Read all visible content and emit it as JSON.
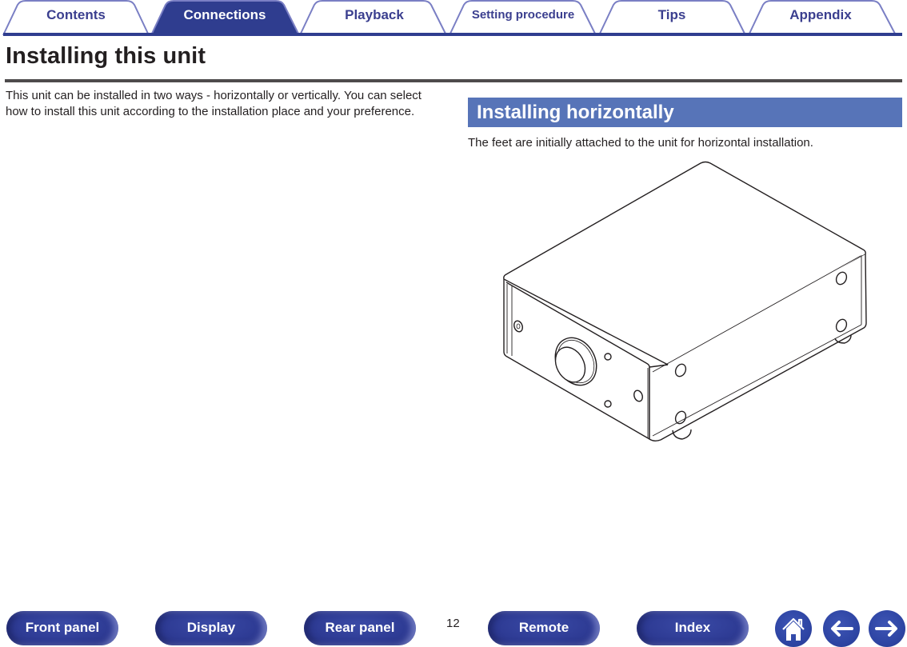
{
  "tabs": [
    {
      "label": "Contents",
      "active": false
    },
    {
      "label": "Connections",
      "active": true
    },
    {
      "label": "Playback",
      "active": false
    },
    {
      "label": "Setting procedure",
      "active": false
    },
    {
      "label": "Tips",
      "active": false
    },
    {
      "label": "Appendix",
      "active": false
    }
  ],
  "page": {
    "title": "Installing this unit",
    "intro": "This unit can be installed in two ways - horizontally or vertically. You can select how to install this unit according to the installation place and your preference.",
    "section": {
      "title": "Installing horizontally",
      "text": "The feet are initially attached to the unit for horizontal installation.",
      "figure": "unit-horizontal-illustration"
    }
  },
  "footer": {
    "buttons": [
      {
        "label": "Front panel"
      },
      {
        "label": "Display"
      },
      {
        "label": "Rear panel"
      },
      {
        "label": "Remote"
      },
      {
        "label": "Index"
      }
    ],
    "page_number": "12",
    "nav_icons": [
      "home-icon",
      "back-arrow-icon",
      "forward-arrow-icon"
    ]
  },
  "colors": {
    "tab_active": "#2f3d8f",
    "tab_outline": "#7a7fc4",
    "accent_rule": "#2f3d8f",
    "section_bar": "#5774b8",
    "title_rule": "#4e4b4c"
  }
}
